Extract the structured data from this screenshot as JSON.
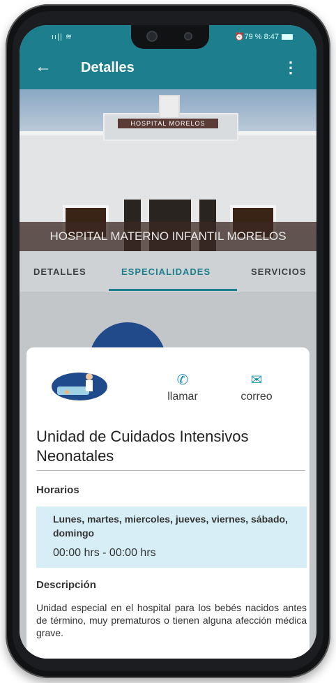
{
  "statusbar": {
    "left": "ıı|| ≋",
    "right": "⏰79 % 8:47"
  },
  "appbar": {
    "back_icon": "arrow-back-icon",
    "title": "Detalles",
    "more_icon": "more-vert-icon"
  },
  "hero": {
    "sign_text": "HOSPITAL MORELOS",
    "caption": "HOSPITAL MATERNO INFANTIL MORELOS"
  },
  "tabs": [
    {
      "label": "DETALLES",
      "active": false
    },
    {
      "label": "ESPECIALIDADES",
      "active": true
    },
    {
      "label": "SERVICIOS",
      "active": false
    }
  ],
  "sheet": {
    "actions": [
      {
        "label": "llamar",
        "icon": "phone-icon"
      },
      {
        "label": "correo",
        "icon": "mail-icon"
      }
    ],
    "title": "Unidad de Cuidados Intensivos Neonatales",
    "horarios_label": "Horarios",
    "days": "Lunes, martes, miercoles, jueves, viernes, sábado, domingo",
    "time": "00:00 hrs - 00:00 hrs",
    "descripcion_label": "Descripción",
    "description": "Unidad especial en el hospital para los bebés nacidos antes de término, muy prematuros o tienen alguna afección médica grave."
  },
  "colors": {
    "primary": "#1d7f8e",
    "accent": "#1d8fb0",
    "hours_bg": "#d7eef7"
  }
}
